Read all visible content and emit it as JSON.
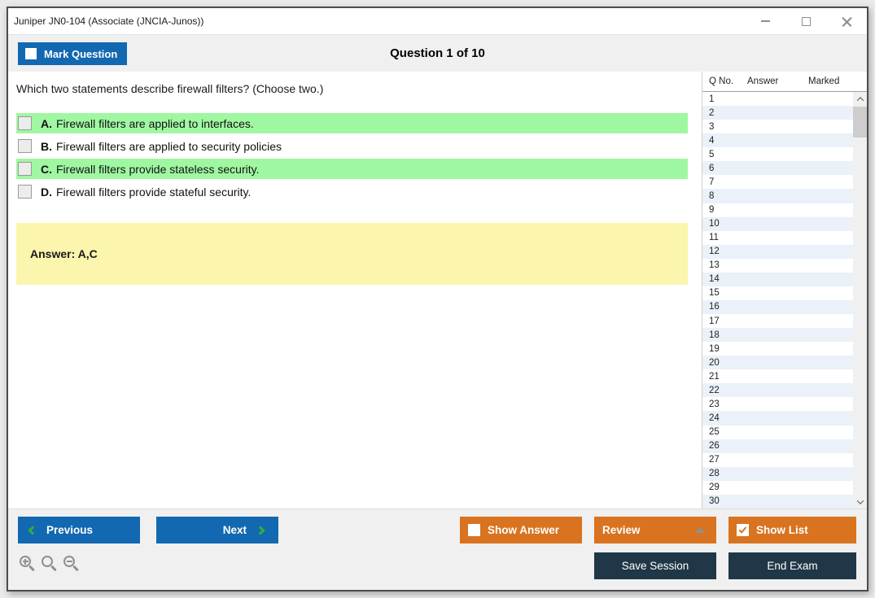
{
  "window": {
    "title": "Juniper JN0-104 (Associate (JNCIA-Junos))",
    "controls": [
      "minimize-icon",
      "maximize-icon",
      "close-icon"
    ]
  },
  "header": {
    "mark_question_label": "Mark Question",
    "mark_question_checked": false,
    "question_counter": "Question 1 of 10"
  },
  "question": {
    "text": "Which two statements describe firewall filters? (Choose two.)",
    "options": [
      {
        "letter": "A.",
        "text": "Firewall filters are applied to interfaces.",
        "highlighted": true,
        "checked": false
      },
      {
        "letter": "B.",
        "text": "Firewall filters are applied to security policies",
        "highlighted": false,
        "checked": false
      },
      {
        "letter": "C.",
        "text": "Firewall filters provide stateless security.",
        "highlighted": true,
        "checked": false
      },
      {
        "letter": "D.",
        "text": "Firewall filters provide stateful security.",
        "highlighted": false,
        "checked": false
      }
    ],
    "answer_label": "Answer: A,C"
  },
  "question_list": {
    "columns": [
      "Q No.",
      "Answer",
      "Marked"
    ],
    "rows": [
      "1",
      "2",
      "3",
      "4",
      "5",
      "6",
      "7",
      "8",
      "9",
      "10",
      "11",
      "12",
      "13",
      "14",
      "15",
      "16",
      "17",
      "18",
      "19",
      "20",
      "21",
      "22",
      "23",
      "24",
      "25",
      "26",
      "27",
      "28",
      "29",
      "30"
    ]
  },
  "footer": {
    "previous_label": "Previous",
    "next_label": "Next",
    "show_answer_label": "Show Answer",
    "show_answer_checked": false,
    "review_label": "Review",
    "show_list_label": "Show List",
    "show_list_checked": true,
    "save_session_label": "Save Session",
    "end_exam_label": "End Exam"
  },
  "colors": {
    "accent_blue": "#1268b1",
    "accent_orange": "#d9731f",
    "accent_navy": "#1f3747",
    "highlight_green": "#a0f7a2",
    "answer_yellow": "#fbf5ad",
    "chevron_green": "#2fb135",
    "row_alt_blue": "#eaf1f8"
  }
}
